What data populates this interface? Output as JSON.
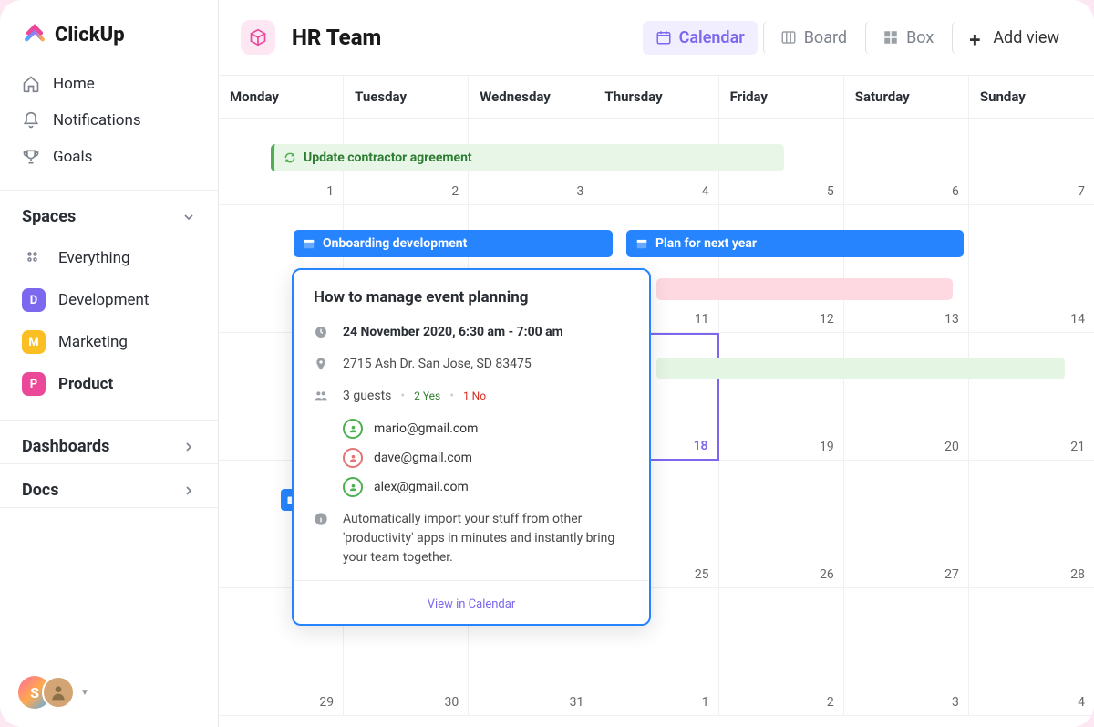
{
  "logo_text": "ClickUp",
  "nav": {
    "home": "Home",
    "notifications": "Notifications",
    "goals": "Goals"
  },
  "spaces_header": "Spaces",
  "spaces": {
    "everything": "Everything",
    "development": {
      "initial": "D",
      "label": "Development",
      "color": "#7b68ee"
    },
    "marketing": {
      "initial": "M",
      "label": "Marketing",
      "color": "#fbbf24"
    },
    "product": {
      "initial": "P",
      "label": "Product",
      "color": "#ec4899"
    }
  },
  "dashboards_header": "Dashboards",
  "docs_header": "Docs",
  "user_avatar_initial": "S",
  "main": {
    "space_title": "HR Team",
    "views": {
      "calendar": "Calendar",
      "board": "Board",
      "box": "Box",
      "add": "Add view"
    }
  },
  "days": [
    "Monday",
    "Tuesday",
    "Wednesday",
    "Thursday",
    "Friday",
    "Saturday",
    "Sunday"
  ],
  "row0_dates": [
    "",
    "",
    "",
    "",
    "",
    "",
    ""
  ],
  "row1_dates": [
    "1",
    "2",
    "3",
    "4",
    "5",
    "6",
    "7"
  ],
  "row2_dates": [
    "",
    "",
    "",
    "11",
    "12",
    "13",
    "14"
  ],
  "row3_dates": [
    "",
    "",
    "",
    "18",
    "19",
    "20",
    "21"
  ],
  "row4_dates": [
    "",
    "",
    "",
    "25",
    "26",
    "27",
    "28"
  ],
  "row5_dates": [
    "29",
    "30",
    "31",
    "1",
    "2",
    "3",
    "4"
  ],
  "events": {
    "contractor": "Update contractor agreement",
    "onboarding": "Onboarding development",
    "plan": "Plan for next year"
  },
  "popover": {
    "title": "How to manage event planning",
    "datetime": "24 November 2020, 6:30 am - 7:00 am",
    "location": "2715 Ash Dr. San Jose, SD 83475",
    "guests_label": "3 guests",
    "yes": "2 Yes",
    "no": "1 No",
    "g1": "mario@gmail.com",
    "g2": "dave@gmail.com",
    "g3": "alex@gmail.com",
    "info": "Automatically import your stuff from other 'productivity' apps in minutes and instantly bring your team together.",
    "footer": "View in Calendar"
  }
}
